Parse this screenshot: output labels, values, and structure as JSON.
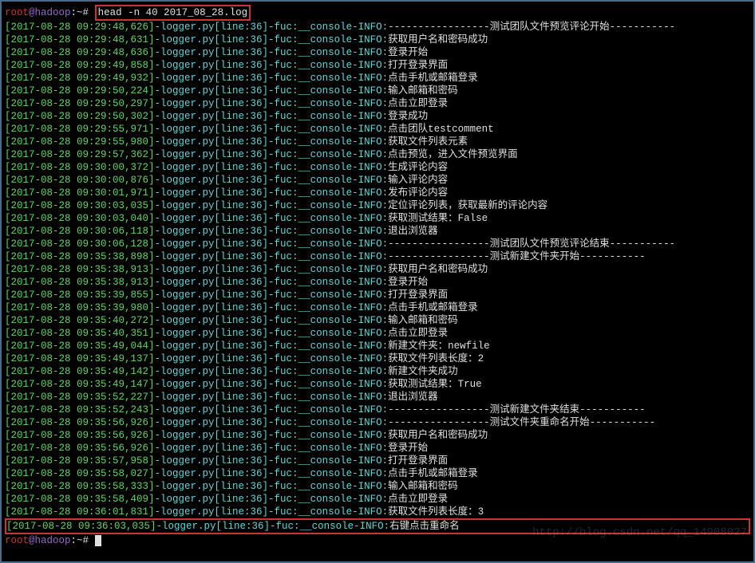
{
  "prompt": {
    "user": "root",
    "at": "@",
    "host": "hadoop",
    "path": ":~#",
    "command": "head -n 40 2017_08_28.log"
  },
  "log_prefix": {
    "source": "-logger.py[line:36]-fuc:__console-INFO:"
  },
  "lines": [
    {
      "ts": "[2017-08-28 09:29:48,626]",
      "msg": "-----------------测试团队文件预览评论开始-----------"
    },
    {
      "ts": "[2017-08-28 09:29:48,631]",
      "msg": "获取用户名和密码成功"
    },
    {
      "ts": "[2017-08-28 09:29:48,636]",
      "msg": "登录开始"
    },
    {
      "ts": "[2017-08-28 09:29:49,858]",
      "msg": "打开登录界面"
    },
    {
      "ts": "[2017-08-28 09:29:49,932]",
      "msg": "点击手机或邮箱登录"
    },
    {
      "ts": "[2017-08-28 09:29:50,224]",
      "msg": "输入邮箱和密码"
    },
    {
      "ts": "[2017-08-28 09:29:50,297]",
      "msg": "点击立即登录"
    },
    {
      "ts": "[2017-08-28 09:29:50,302]",
      "msg": "登录成功"
    },
    {
      "ts": "[2017-08-28 09:29:55,971]",
      "msg": "点击团队testcomment"
    },
    {
      "ts": "[2017-08-28 09:29:55,980]",
      "msg": "获取文件列表元素"
    },
    {
      "ts": "[2017-08-28 09:29:57,362]",
      "msg": "点击预览，进入文件预览界面"
    },
    {
      "ts": "[2017-08-28 09:30:00,372]",
      "msg": "生成评论内容"
    },
    {
      "ts": "[2017-08-28 09:30:00,876]",
      "msg": "输入评论内容"
    },
    {
      "ts": "[2017-08-28 09:30:01,971]",
      "msg": "发布评论内容"
    },
    {
      "ts": "[2017-08-28 09:30:03,035]",
      "msg": "定位评论列表，获取最新的评论内容"
    },
    {
      "ts": "[2017-08-28 09:30:03,040]",
      "msg": "获取测试结果：False"
    },
    {
      "ts": "[2017-08-28 09:30:06,118]",
      "msg": "退出浏览器"
    },
    {
      "ts": "[2017-08-28 09:30:06,128]",
      "msg": "-----------------测试团队文件预览评论结束-----------"
    },
    {
      "ts": "[2017-08-28 09:35:38,898]",
      "msg": "-----------------测试新建文件夹开始-----------"
    },
    {
      "ts": "[2017-08-28 09:35:38,913]",
      "msg": "获取用户名和密码成功"
    },
    {
      "ts": "[2017-08-28 09:35:38,913]",
      "msg": "登录开始"
    },
    {
      "ts": "[2017-08-28 09:35:39,855]",
      "msg": "打开登录界面"
    },
    {
      "ts": "[2017-08-28 09:35:39,980]",
      "msg": "点击手机或邮箱登录"
    },
    {
      "ts": "[2017-08-28 09:35:40,272]",
      "msg": "输入邮箱和密码"
    },
    {
      "ts": "[2017-08-28 09:35:40,351]",
      "msg": "点击立即登录"
    },
    {
      "ts": "[2017-08-28 09:35:49,044]",
      "msg": "新建文件夹：newfile"
    },
    {
      "ts": "[2017-08-28 09:35:49,137]",
      "msg": "获取文件列表长度：2"
    },
    {
      "ts": "[2017-08-28 09:35:49,142]",
      "msg": "新建文件夹成功"
    },
    {
      "ts": "[2017-08-28 09:35:49,147]",
      "msg": "获取测试结果：True"
    },
    {
      "ts": "[2017-08-28 09:35:52,227]",
      "msg": "退出浏览器"
    },
    {
      "ts": "[2017-08-28 09:35:52,243]",
      "msg": "-----------------测试新建文件夹结束-----------"
    },
    {
      "ts": "[2017-08-28 09:35:56,926]",
      "msg": "-----------------测试文件夹重命名开始-----------"
    },
    {
      "ts": "[2017-08-28 09:35:56,926]",
      "msg": "获取用户名和密码成功"
    },
    {
      "ts": "[2017-08-28 09:35:56,926]",
      "msg": "登录开始"
    },
    {
      "ts": "[2017-08-28 09:35:57,958]",
      "msg": "打开登录界面"
    },
    {
      "ts": "[2017-08-28 09:35:58,027]",
      "msg": "点击手机或邮箱登录"
    },
    {
      "ts": "[2017-08-28 09:35:58,333]",
      "msg": "输入邮箱和密码"
    },
    {
      "ts": "[2017-08-28 09:35:58,409]",
      "msg": "点击立即登录"
    },
    {
      "ts": "[2017-08-28 09:36:01,831]",
      "msg": "获取文件列表长度：3"
    }
  ],
  "highlighted_line": {
    "ts": "[2017-08-28 09:36:03,035]",
    "msg": "右键点击重命名"
  },
  "watermark": "http://blog.csdn.net/qq_14908027"
}
